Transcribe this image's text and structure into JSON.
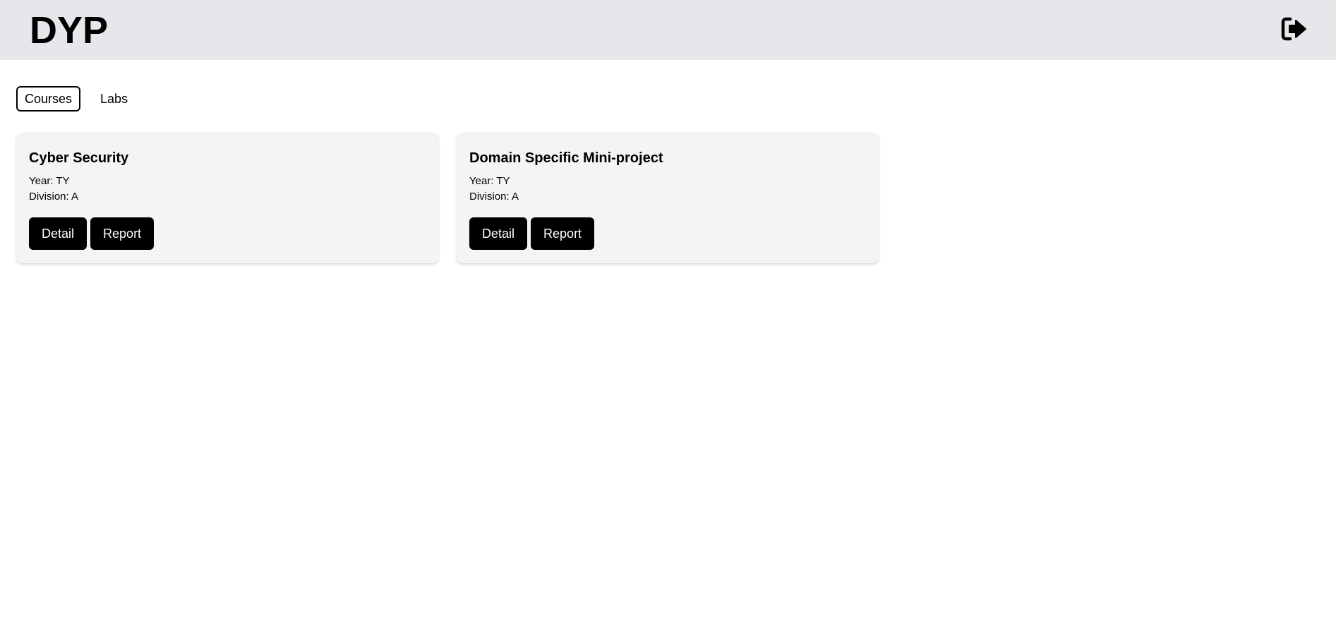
{
  "header": {
    "logo": "DYP",
    "logout_icon": "sign-out-icon"
  },
  "tabs": [
    {
      "label": "Courses",
      "active": true
    },
    {
      "label": "Labs",
      "active": false
    }
  ],
  "cards": [
    {
      "title": "Cyber Security",
      "year": "Year: TY",
      "division": "Division: A",
      "detail_label": "Detail",
      "report_label": "Report"
    },
    {
      "title": "Domain Specific Mini-project",
      "year": "Year: TY",
      "division": "Division: A",
      "detail_label": "Detail",
      "report_label": "Report"
    }
  ]
}
